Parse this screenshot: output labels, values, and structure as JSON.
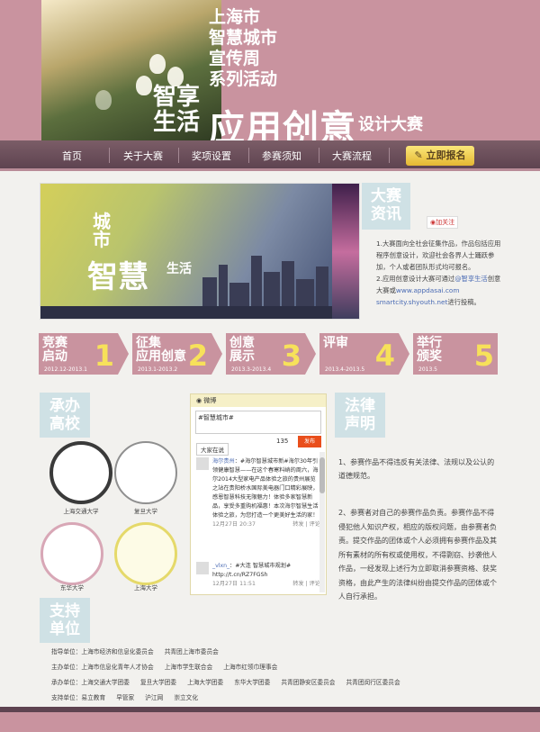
{
  "banner": {
    "sub_title": "上海市\n智慧城市\n宣传周\n系列活动",
    "left_title": "智享\n生活",
    "main_title": "应用创意",
    "tail_title": "设计大赛"
  },
  "nav": {
    "items": [
      "首页",
      "关于大赛",
      "奖项设置",
      "参赛须知",
      "大赛流程"
    ],
    "register": "立即报名"
  },
  "hero": {
    "t1": "城市",
    "t2": "智慧",
    "t3": "生活"
  },
  "news": {
    "title": "大赛\n资讯",
    "follow": "加关注",
    "item1": "1.大赛面向全社会征集作品，作品包括应用程序创意设计，欢迎社会各界人士踊跃参加，个人或者团队形式均可报名。",
    "item2_prefix": "2.应用创意设计大赛可通过",
    "item2_link1": "@智享生活",
    "item2_mid": "创意大赛或",
    "item2_link2": "www.appdasai.com",
    "item2_link3": "smartcity.shyouth.net",
    "item2_suffix": "进行投稿。"
  },
  "steps": [
    {
      "title": "竞赛\n启动",
      "date": "2012.12-2013.1",
      "num": "1"
    },
    {
      "title": "征集\n应用创意",
      "date": "2013.1-2013.2",
      "num": "2"
    },
    {
      "title": "创意\n展示",
      "date": "2013.3-2013.4",
      "num": "3"
    },
    {
      "title": "评审",
      "date": "2013.4-2013.5",
      "num": "4"
    },
    {
      "title": "举行\n颁奖",
      "date": "2013.5",
      "num": "5"
    }
  ],
  "hosts": {
    "title": "承办\n高校",
    "logos": [
      "上海交通大学",
      "复旦大学",
      "东华大学",
      "上海大学"
    ]
  },
  "weibo": {
    "header": "微博",
    "input": "#智慧城市#",
    "count": "135",
    "send": "发布",
    "tab": "大家在说",
    "post1_user": "海尔贵州",
    "post1_text": "：#海尔智慧城市新#海尔30年引领健康智慧——在这个春寒料峭的周六，海尔2014大型家电产品体验之旅的贵州展览之站在贵阳桥水国际美电器门口精彩展映，感恩智慧科技无限魅力！体验多家智慧新品，享受多重购机福惠！本次海尔智慧生活体验之旅，为您打造一个更美好生活的家！",
    "post1_time": "12月27日 20:37",
    "post1_actions": "转发 | 评论",
    "post2_user": "_vlxn_",
    "post2_text": "：#大连 智慧城市规划# http://t.cn/RZ7FGSh",
    "post2_time": "12月27日 11:51",
    "post2_actions": "转发 | 评论"
  },
  "legal": {
    "title": "法律\n声明",
    "text1": "1、参赛作品不得违反有关法律、法规以及公认的道德规范。",
    "text2": "2、参赛者对自己的参赛作品负责。参赛作品不得侵犯他人知识产权，相应的版权问题，由参赛者负责。提交作品的团体或个人必须拥有参赛作品及其所有素材的所有权或使用权，不得剽窃、抄袭他人作品，一经发现上述行为立即取消参赛资格、获奖资格，由此产生的法律纠纷由提交作品的团体或个人自行承担。"
  },
  "support": {
    "title": "支持\n单位",
    "rows": [
      [
        "指导单位：上海市经济和信息化委员会",
        "共青团上海市委员会"
      ],
      [
        "主办单位：上海市信息化青年人才协会",
        "上海市学生联合会",
        "上海市红领巾理事会"
      ],
      [
        "承办单位：上海交通大学团委",
        "复旦大学团委",
        "上海大学团委",
        "东华大学团委",
        "共青团静安区委员会",
        "共青团闵行区委员会"
      ],
      [
        "支持单位：易立教育",
        "早管家",
        "沪江网",
        "崇立文化"
      ]
    ]
  },
  "colors": {
    "accent": "#c9939f",
    "nav": "#5e4350",
    "tile": "#cfe1e5",
    "step_number": "#f7e15a"
  }
}
